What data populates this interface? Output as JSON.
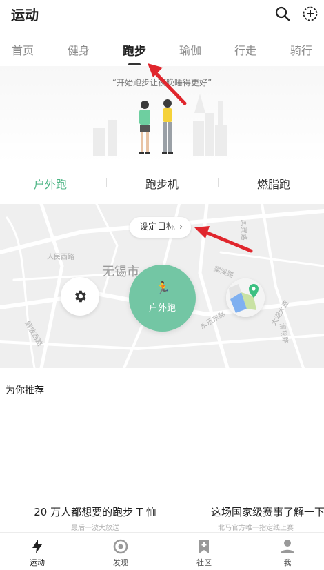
{
  "header": {
    "title": "运动",
    "icons": [
      "search-icon",
      "add-circle-icon"
    ]
  },
  "tabs": [
    {
      "label": "首页",
      "active": false
    },
    {
      "label": "健身",
      "active": false
    },
    {
      "label": "跑步",
      "active": true
    },
    {
      "label": "瑜伽",
      "active": false
    },
    {
      "label": "行走",
      "active": false
    },
    {
      "label": "骑行",
      "active": false
    }
  ],
  "hero": {
    "slogan": "“开始跑步让夜晚睡得更好”"
  },
  "run_types": [
    {
      "label": "户外跑",
      "active": true
    },
    {
      "label": "跑步机",
      "active": false
    },
    {
      "label": "燃脂跑",
      "active": false
    }
  ],
  "map": {
    "goal_button": "设定目标",
    "city": "无锡市",
    "streets": [
      "人民西路",
      "太湖大道",
      "永乐东路",
      "梁溪路",
      "解放西路",
      "清扬路",
      "凤宾路"
    ],
    "start_button": "户外跑"
  },
  "recommend": {
    "title": "为你推荐",
    "cards": [
      {
        "title": "20 万人都想要的跑步 T 恤",
        "subtitle": "最后一波大放送"
      },
      {
        "title": "这场国家级赛事了解一下",
        "subtitle": "北马官方唯一指定线上赛"
      }
    ]
  },
  "bottom_nav": [
    {
      "label": "运动",
      "icon": "lightning-icon",
      "active": true
    },
    {
      "label": "发现",
      "icon": "target-icon",
      "active": false
    },
    {
      "label": "社区",
      "icon": "bookmark-plus-icon",
      "active": false
    },
    {
      "label": "我",
      "icon": "person-icon",
      "active": false
    }
  ],
  "colors": {
    "accent": "#4fb686",
    "start_button": "#73c6a4",
    "annotation": "#e0262d"
  }
}
